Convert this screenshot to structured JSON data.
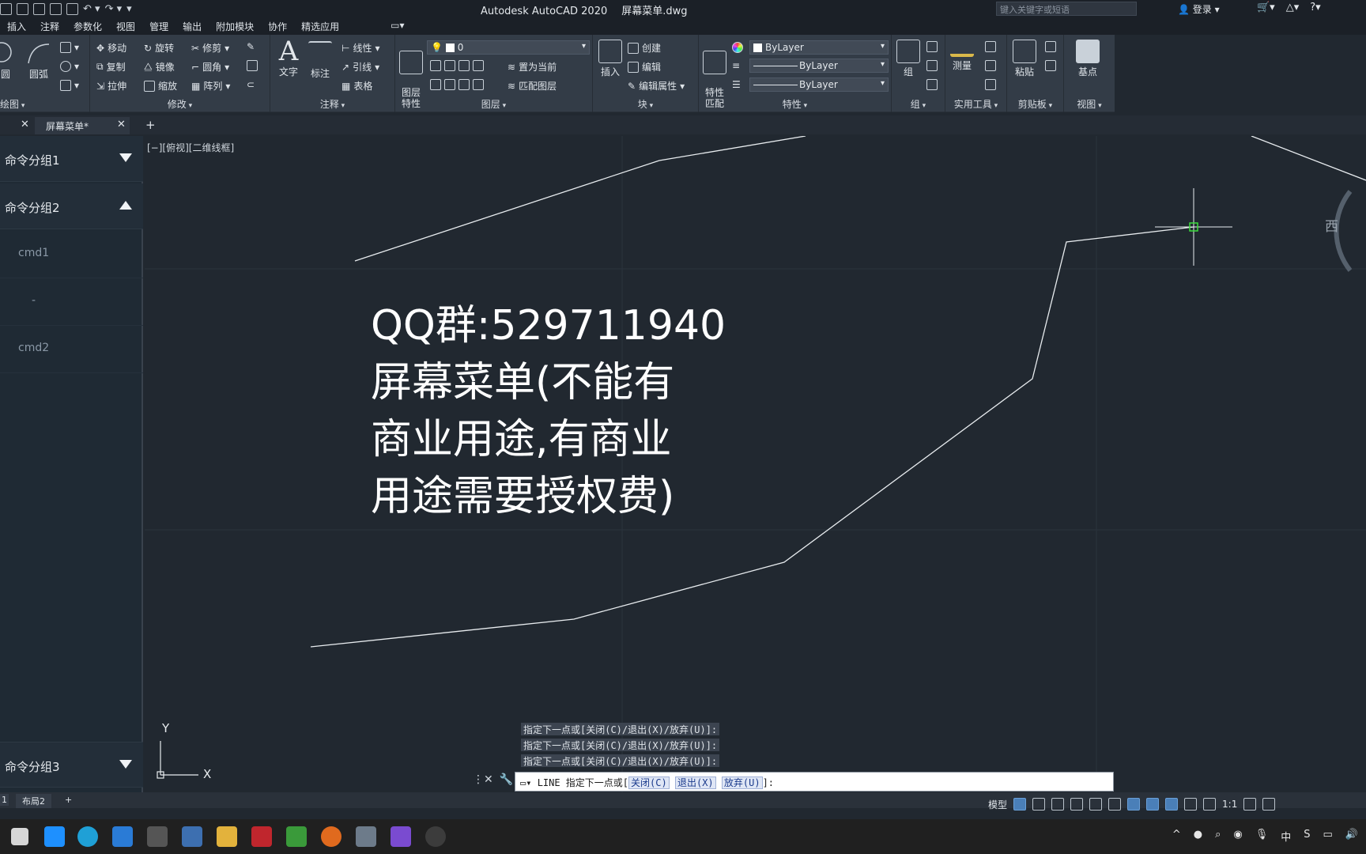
{
  "title": {
    "app": "Autodesk AutoCAD 2020",
    "file": "屏幕菜单.dwg",
    "search_placeholder": "键入关键字或短语",
    "login": "登录"
  },
  "menu": [
    "插入",
    "注释",
    "参数化",
    "视图",
    "管理",
    "输出",
    "附加模块",
    "协作",
    "精选应用"
  ],
  "ribbon": {
    "draw": {
      "circle": "圆",
      "arc": "圆弧",
      "title": "绘图"
    },
    "modify": {
      "move": "移动",
      "rotate": "旋转",
      "trim": "修剪",
      "copy": "复制",
      "mirror": "镜像",
      "fillet": "圆角",
      "stretch": "拉伸",
      "scale": "缩放",
      "array": "阵列",
      "title": "修改"
    },
    "annotation": {
      "text": "文字",
      "dimension": "标注",
      "linear": "线性",
      "leader": "引线",
      "table": "表格",
      "title": "注释"
    },
    "layers": {
      "props": "图层\n特性",
      "layer_value": "0",
      "set_current": "置为当前",
      "match": "匹配图层",
      "title": "图层"
    },
    "block": {
      "insert": "插入",
      "create": "创建",
      "edit": "编辑",
      "edit_attr": "编辑属性",
      "title": "块"
    },
    "properties": {
      "match": "特性\n匹配",
      "color": "ByLayer",
      "linetype": "ByLayer",
      "lineweight": "ByLayer",
      "title": "特性"
    },
    "groups": {
      "group": "组",
      "title": "组"
    },
    "utilities": {
      "measure": "测量",
      "title": "实用工具"
    },
    "clipboard": {
      "paste": "粘贴",
      "title": "剪贴板"
    },
    "view": {
      "base": "基点",
      "title": "视图"
    }
  },
  "doc_tabs": {
    "active": "屏幕菜单*"
  },
  "palette": {
    "group1": "命令分组1",
    "group2": "命令分组2",
    "item1": "cmd1",
    "sep": "-",
    "item2": "cmd2",
    "group3": "命令分组3"
  },
  "canvas": {
    "view_label": "[−][俯视][二维线框]",
    "watermark": [
      "QQ群:529711940",
      "屏幕菜单(不能有",
      "商业用途,有商业",
      "用途需要授权费)"
    ],
    "compass_west": "西",
    "ucs_x": "X",
    "ucs_y": "Y"
  },
  "command": {
    "history": [
      "指定下一点或[关闭(C)/退出(X)/放弃(U)]:",
      "指定下一点或[关闭(C)/退出(X)/放弃(U)]:",
      "指定下一点或[关闭(C)/退出(X)/放弃(U)]:"
    ],
    "prefix": "LINE 指定下一点或[",
    "opt_close": "关闭(C)",
    "opt_exit": "退出(X)",
    "opt_undo": "放弃(U)",
    "suffix": "]:"
  },
  "layout_tabs": {
    "layout1_partial": "1",
    "layout2": "布局2"
  },
  "status": {
    "model": "模型",
    "scale": "1:1"
  },
  "tray": {
    "ime": "中"
  }
}
